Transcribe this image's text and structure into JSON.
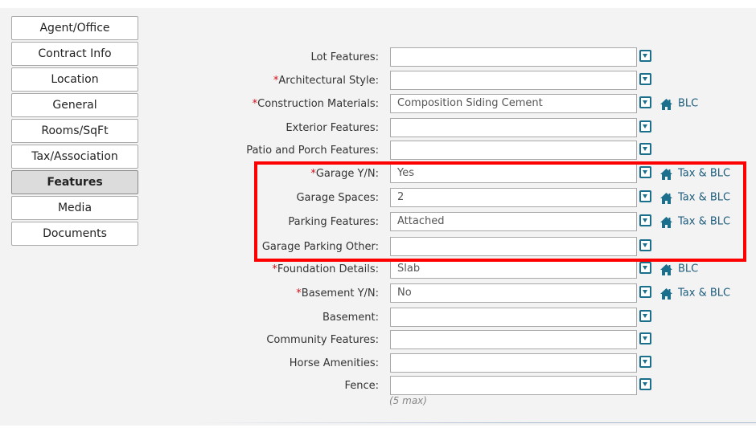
{
  "nav": {
    "items": [
      {
        "label": "Agent/Office"
      },
      {
        "label": "Contract Info"
      },
      {
        "label": "Location"
      },
      {
        "label": "General"
      },
      {
        "label": "Rooms/SqFt"
      },
      {
        "label": "Tax/Association"
      },
      {
        "label": "Features",
        "active": true
      },
      {
        "label": "Media"
      },
      {
        "label": "Documents"
      }
    ]
  },
  "fields": [
    {
      "label": "Lot Features:",
      "required": false,
      "value": "",
      "source": ""
    },
    {
      "label": "Architectural Style:",
      "required": true,
      "value": "",
      "source": ""
    },
    {
      "label": "Construction Materials:",
      "required": true,
      "value": "Composition Siding Cement",
      "source": "BLC"
    },
    {
      "label": "Exterior Features:",
      "required": false,
      "value": "",
      "source": ""
    },
    {
      "label": "Patio and Porch Features:",
      "required": false,
      "value": "",
      "source": ""
    },
    {
      "label": "Garage Y/N:",
      "required": true,
      "value": "Yes",
      "source": "Tax & BLC"
    },
    {
      "label": "Garage Spaces:",
      "required": false,
      "value": "2",
      "source": "Tax & BLC"
    },
    {
      "label": "Parking Features:",
      "required": false,
      "value": "Attached",
      "source": "Tax & BLC"
    },
    {
      "label": "Garage Parking Other:",
      "required": false,
      "value": "",
      "source": ""
    },
    {
      "label": "Foundation Details:",
      "required": true,
      "value": "Slab",
      "source": "BLC"
    },
    {
      "label": "Basement Y/N:",
      "required": true,
      "value": "No",
      "source": "Tax & BLC"
    },
    {
      "label": "Basement:",
      "required": false,
      "value": "",
      "source": ""
    },
    {
      "label": "Community Features:",
      "required": false,
      "value": "",
      "source": ""
    },
    {
      "label": "Horse Amenities:",
      "required": false,
      "value": "",
      "source": ""
    },
    {
      "label": "Fence:",
      "required": false,
      "value": "",
      "source": ""
    }
  ],
  "fence_note": "(5 max)",
  "required_marker": "*",
  "colors": {
    "required": "#d0111b",
    "icon": "#1a6f8c",
    "source_text": "#1e5d7d",
    "highlight": "#ff0000",
    "active_tab": "#dcdcdc"
  },
  "icons": {
    "dropdown": "dropdown-arrow-icon",
    "source": "house-icon"
  }
}
